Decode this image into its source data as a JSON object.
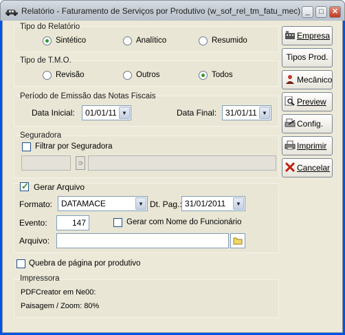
{
  "window": {
    "title": "Relatório - Faturamento de Serviços por Produtivo (w_sof_rel_tm_fatu_mec)"
  },
  "tipo_relatorio": {
    "label": "Tipo do Relatório",
    "options": [
      {
        "label": "Sintético",
        "selected": true
      },
      {
        "label": "Analítico",
        "selected": false
      },
      {
        "label": "Resumido",
        "selected": false
      }
    ]
  },
  "tipo_tmo": {
    "label": "Tipo de T.M.O.",
    "options": [
      {
        "label": "Revisão",
        "selected": false
      },
      {
        "label": "Outros",
        "selected": false
      },
      {
        "label": "Todos",
        "selected": true
      }
    ]
  },
  "periodo": {
    "label": "Período de Emissão das Notas Fiscais",
    "data_inicial_label": "Data Inicial:",
    "data_inicial_value": "01/01/11",
    "data_final_label": "Data Final:",
    "data_final_value": "31/01/11"
  },
  "seguradora": {
    "label": "Seguradora",
    "filtrar_label": "Filtrar por Seguradora",
    "filtrar_checked": false
  },
  "arquivo": {
    "gerar_label": "Gerar Arquivo",
    "gerar_checked": true,
    "formato_label": "Formato:",
    "formato_value": "DATAMACE",
    "dt_pag_label": "Dt. Pag.:",
    "dt_pag_value": "31/01/2011",
    "evento_label": "Evento:",
    "evento_value": "147",
    "gerar_nome_label": "Gerar com Nome do Funcionário",
    "gerar_nome_checked": false,
    "arquivo_label": "Arquivo:",
    "arquivo_value": ""
  },
  "quebra": {
    "label": "Quebra de página por produtivo",
    "checked": false
  },
  "impressora": {
    "label": "Impressora",
    "line1": "PDFCreator em Ne00:",
    "line2": "Paisagem / Zoom: 80%"
  },
  "buttons": {
    "empresa": "Empresa",
    "tipos_prod": "Tipos Prod.",
    "mecanico": "Mecânico",
    "preview": "Preview",
    "config": "Config.",
    "imprimir": "Imprimir",
    "cancelar": "Cancelar"
  },
  "icons": {
    "window": "car-icon",
    "empresa": "building-icon",
    "mecanico": "person-icon",
    "preview": "magnifier-icon",
    "config": "printer-config-icon",
    "imprimir": "printer-icon",
    "cancelar": "red-x-icon",
    "arquivo": "folder-icon"
  }
}
